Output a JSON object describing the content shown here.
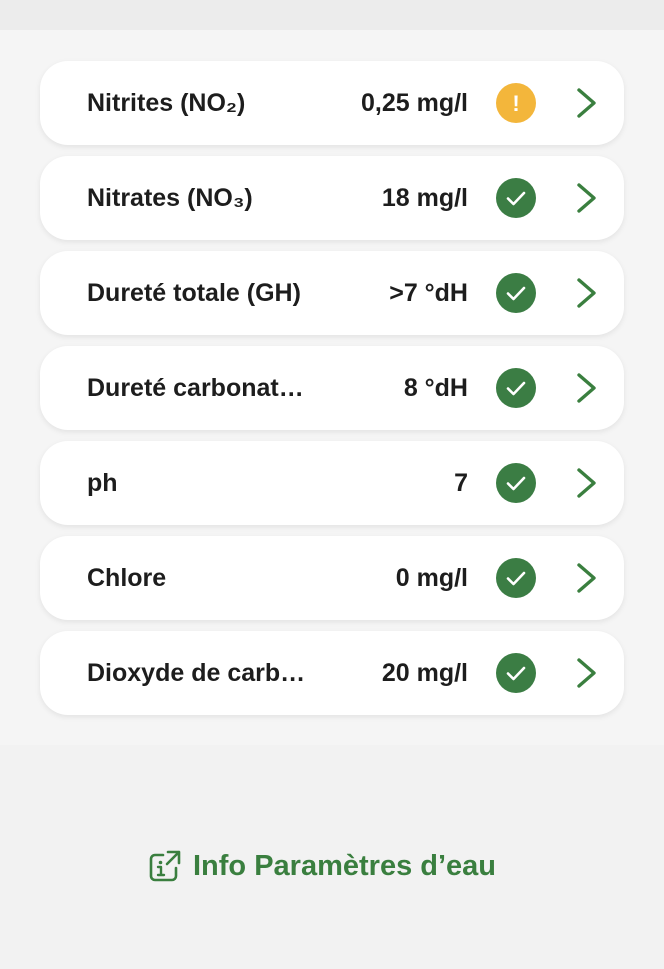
{
  "parameters": [
    {
      "name": "Nitrites (NO₂)",
      "value": "0,25 mg/l",
      "status": "warning",
      "status_symbol": "!"
    },
    {
      "name": "Nitrates (NO₃)",
      "value": "18 mg/l",
      "status": "ok",
      "status_symbol": "check"
    },
    {
      "name": "Dureté totale (GH)",
      "value": ">7 °dH",
      "status": "ok",
      "status_symbol": "check"
    },
    {
      "name": "Dureté carbonat…",
      "value": "8 °dH",
      "status": "ok",
      "status_symbol": "check"
    },
    {
      "name": "ph",
      "value": "7",
      "status": "ok",
      "status_symbol": "check"
    },
    {
      "name": "Chlore",
      "value": "0 mg/l",
      "status": "ok",
      "status_symbol": "check"
    },
    {
      "name": "Dioxyde de carb…",
      "value": "20 mg/l",
      "status": "ok",
      "status_symbol": "check"
    }
  ],
  "info_link": {
    "label": "Info Paramètres d’eau",
    "icon": "external-info-icon"
  },
  "colors": {
    "ok": "#3b7d44",
    "warning": "#f3b63b",
    "accent": "#3a7f3f",
    "text": "#1d1d1d"
  }
}
